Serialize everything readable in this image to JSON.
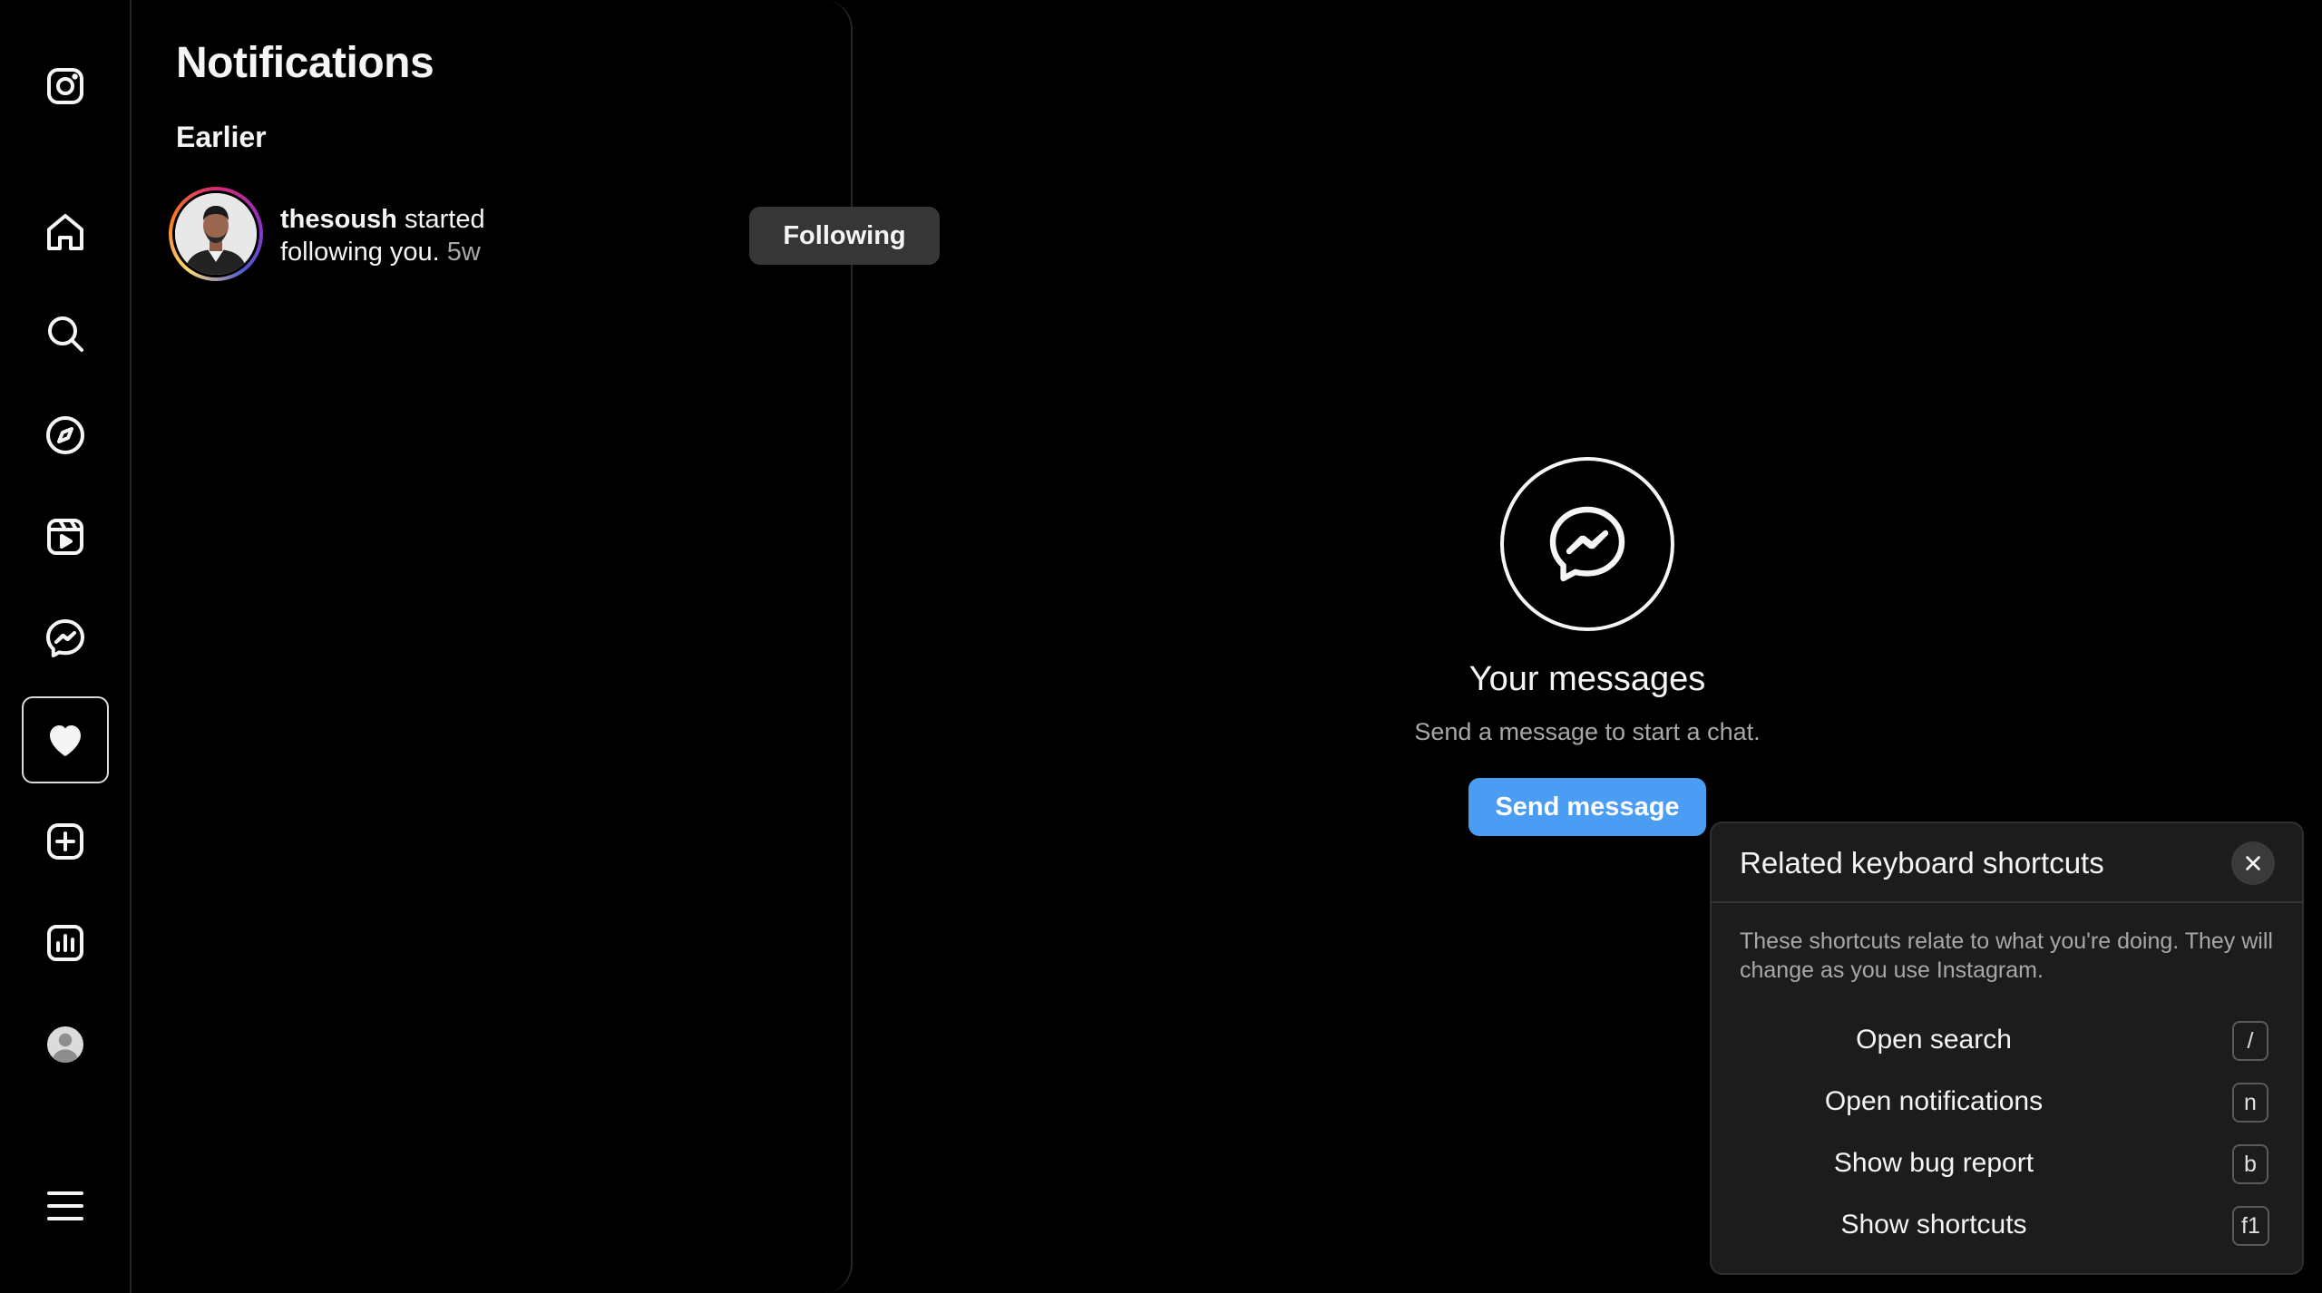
{
  "rail": {
    "items": [
      {
        "icon": "instagram-logo-icon"
      },
      {
        "icon": "home-icon"
      },
      {
        "icon": "search-icon"
      },
      {
        "icon": "explore-compass-icon"
      },
      {
        "icon": "reels-icon"
      },
      {
        "icon": "messenger-icon"
      },
      {
        "icon": "heart-icon",
        "active": true
      },
      {
        "icon": "create-plus-icon"
      },
      {
        "icon": "insights-chart-icon"
      },
      {
        "icon": "profile-avatar-icon"
      },
      {
        "icon": "menu-hamburger-icon"
      }
    ]
  },
  "notifications": {
    "title": "Notifications",
    "section": "Earlier",
    "items": [
      {
        "username": "thesoush",
        "action": " started following you.",
        "time": "5w",
        "button": "Following"
      }
    ]
  },
  "messages": {
    "heading": "Your messages",
    "subtitle": "Send a message to start a chat.",
    "button": "Send message"
  },
  "shortcuts": {
    "title": "Related keyboard shortcuts",
    "description": "These shortcuts relate to what you're doing. They will change as you use Instagram.",
    "items": [
      {
        "label": "Open search",
        "key": "/"
      },
      {
        "label": "Open notifications",
        "key": "n"
      },
      {
        "label": "Show bug report",
        "key": "b"
      },
      {
        "label": "Show shortcuts",
        "key": "f1"
      }
    ]
  },
  "colors": {
    "background": "#000000",
    "accent": "#4a9df3",
    "secondary_button": "#363636",
    "muted_text": "#a8a8a8"
  }
}
